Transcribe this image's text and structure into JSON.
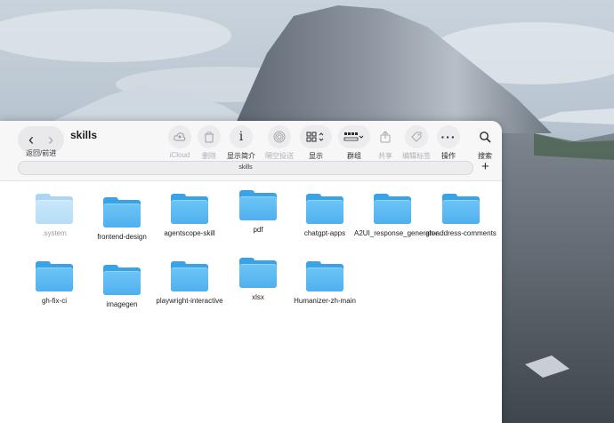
{
  "window": {
    "title": "skills",
    "nav_back": "‹",
    "nav_forward": "›",
    "nav_label": "返回/前进",
    "path": "skills",
    "add": "+"
  },
  "toolbar": {
    "icloud": "iCloud",
    "delete": "删除",
    "info": "显示简介",
    "airdrop": "隔空投送",
    "view": "显示",
    "group": "群组",
    "share": "共享",
    "tags": "编辑标签",
    "action": "操作",
    "search": "搜索"
  },
  "icons": {
    "icloud": "icloud-person-icon",
    "delete": "trash-icon",
    "info": "info-icon",
    "airdrop": "airdrop-icon",
    "view": "grid-view-icon",
    "group": "group-icon",
    "share": "share-icon",
    "tags": "tag-icon",
    "action": "ellipsis-icon",
    "search": "search-icon"
  },
  "colors": {
    "folder": "#4fb0ee",
    "folder_faded": "#b6def7"
  },
  "folders": [
    {
      "name": ".system",
      "faded": true
    },
    {
      "name": "frontend-design"
    },
    {
      "name": "agentscope-skill"
    },
    {
      "name": "pdf"
    },
    {
      "name": "chatgpt-apps"
    },
    {
      "name": "A2UI_response_generator"
    },
    {
      "name": "gh-address-comments"
    },
    {
      "name": "gh-fix-ci"
    },
    {
      "name": "imagegen"
    },
    {
      "name": "playwright-interactive"
    },
    {
      "name": "xlsx"
    },
    {
      "name": "Humanizer-zh-main"
    }
  ]
}
